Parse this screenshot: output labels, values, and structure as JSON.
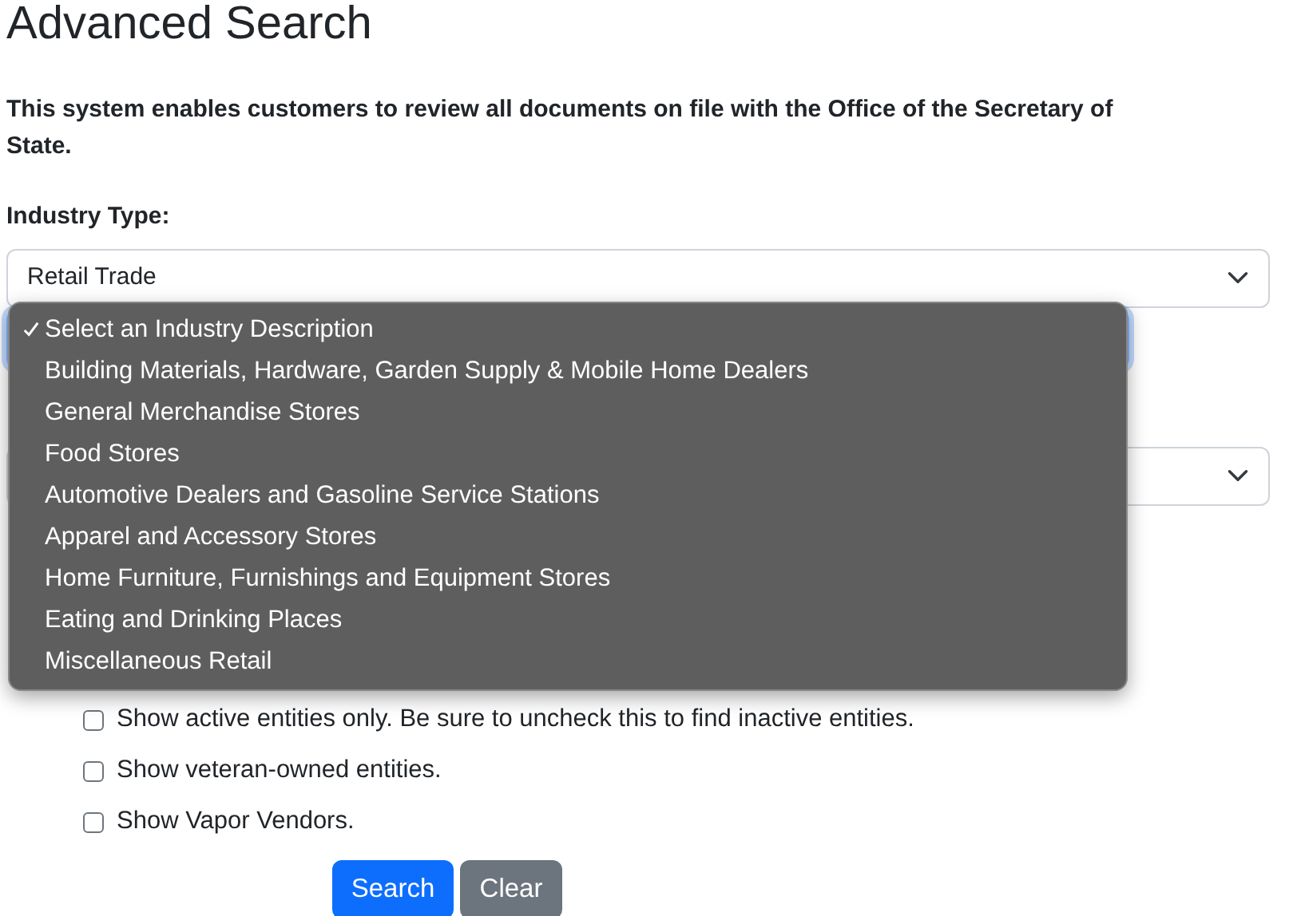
{
  "title": "Advanced Search",
  "intro": "This system enables customers to review all documents on file with the Office of the Secretary of State.",
  "industry_type": {
    "label": "Industry Type:",
    "value": "Retail Trade"
  },
  "industry_description_menu": {
    "options": [
      {
        "label": "Select an Industry Description",
        "selected": true
      },
      {
        "label": "Building Materials, Hardware, Garden Supply & Mobile Home Dealers",
        "selected": false
      },
      {
        "label": "General Merchandise Stores",
        "selected": false
      },
      {
        "label": "Food Stores",
        "selected": false
      },
      {
        "label": "Automotive Dealers and Gasoline Service Stations",
        "selected": false
      },
      {
        "label": "Apparel and Accessory Stores",
        "selected": false
      },
      {
        "label": "Home Furniture, Furnishings and Equipment Stores",
        "selected": false
      },
      {
        "label": "Eating and Drinking Places",
        "selected": false
      },
      {
        "label": "Miscellaneous Retail",
        "selected": false
      }
    ]
  },
  "options": [
    {
      "label": "Show active entities only. Be sure to uncheck this to find inactive entities.",
      "checked": false
    },
    {
      "label": "Show veteran-owned entities.",
      "checked": false
    },
    {
      "label": "Show Vapor Vendors.",
      "checked": false
    }
  ],
  "buttons": [
    {
      "label": "Search",
      "kind": "primary"
    },
    {
      "label": "Clear",
      "kind": "secondary"
    }
  ]
}
